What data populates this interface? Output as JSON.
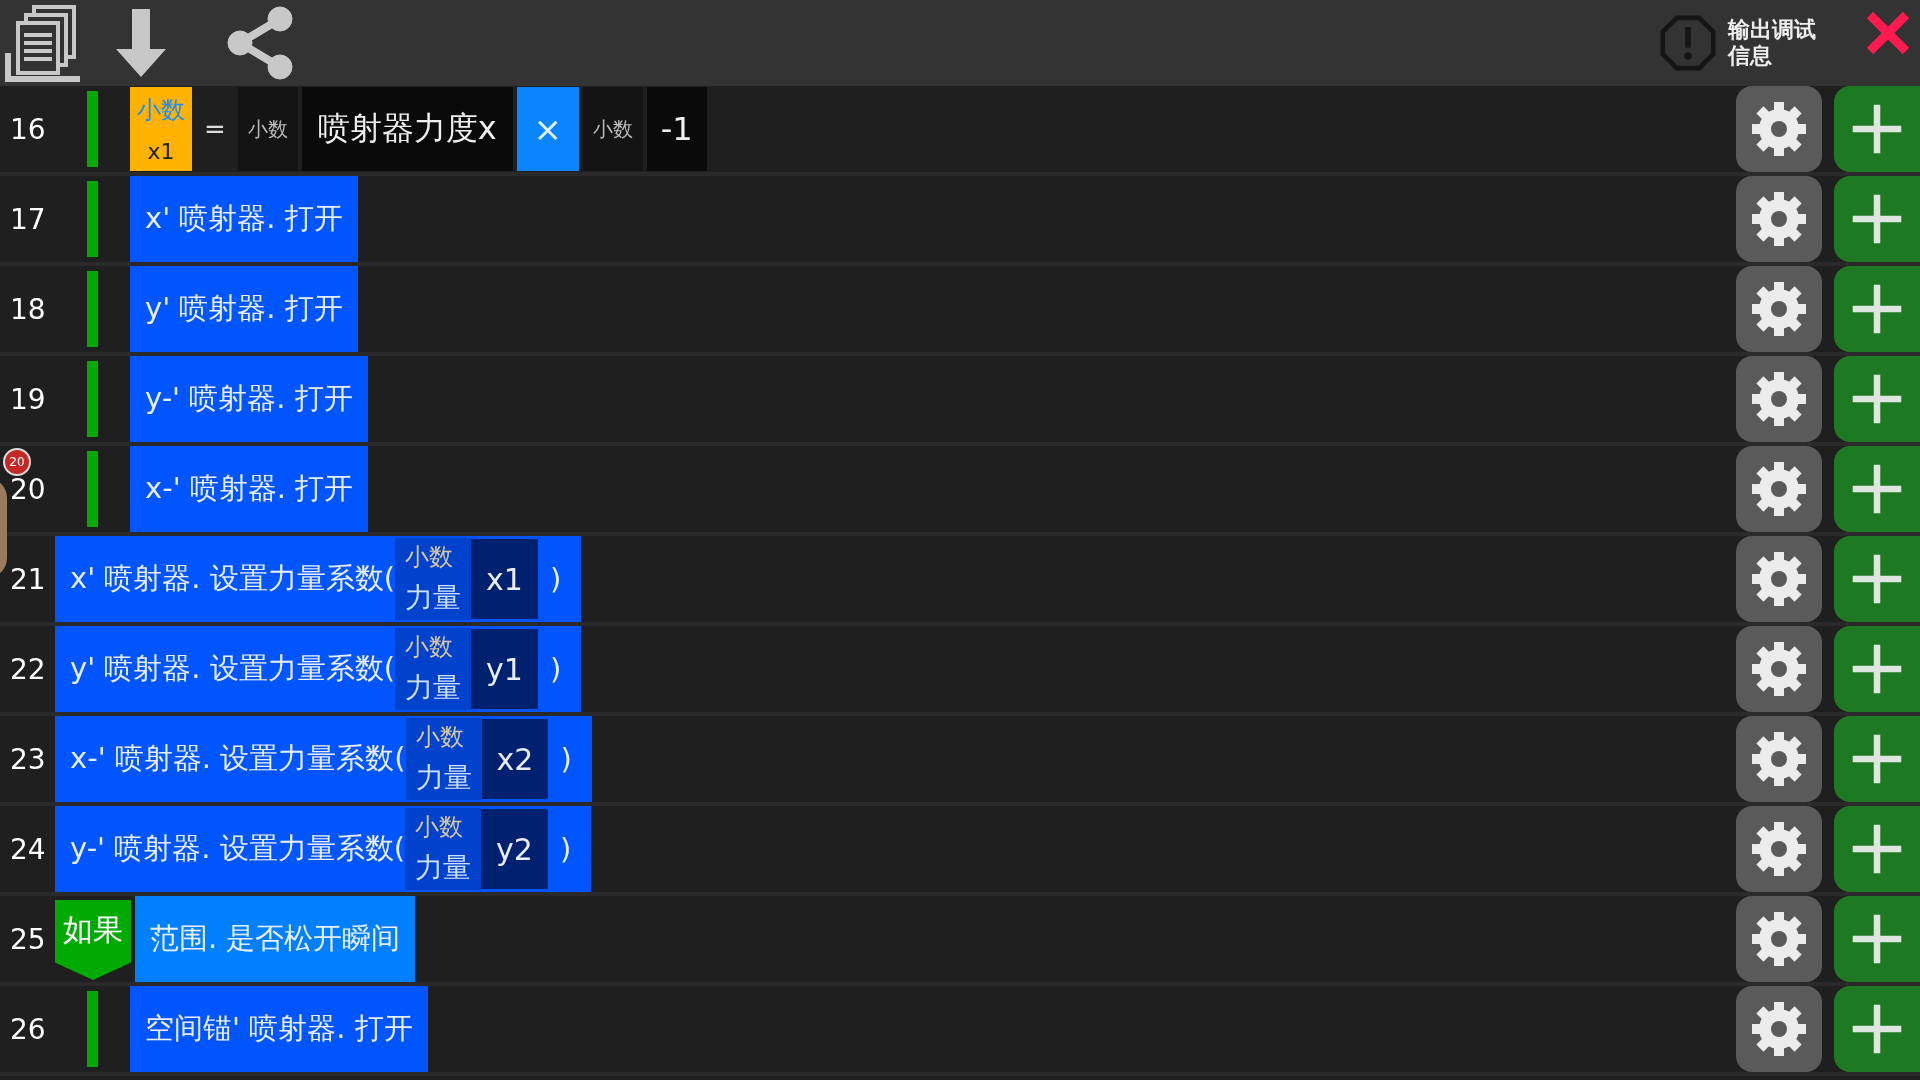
{
  "toolbar": {
    "debug_button": "输出调试信息"
  },
  "rows": [
    {
      "number": "16",
      "indented": true,
      "kind": "assign",
      "target_type": "小数",
      "target_name": "x1",
      "equals": "=",
      "left_type": "小数",
      "left_value": "喷射器力度x",
      "operator": "×",
      "right_type": "小数",
      "right_value": "-1"
    },
    {
      "number": "17",
      "indented": true,
      "kind": "call",
      "text": "x' 喷射器. 打开"
    },
    {
      "number": "18",
      "indented": true,
      "kind": "call",
      "text": "y' 喷射器. 打开"
    },
    {
      "number": "19",
      "indented": true,
      "kind": "call",
      "text": "y-' 喷射器. 打开"
    },
    {
      "number": "20",
      "indented": true,
      "kind": "call",
      "text": "x-' 喷射器. 打开"
    },
    {
      "number": "21",
      "indented": false,
      "kind": "call_param",
      "text": "x' 喷射器. 设置力量系数(",
      "param_type": "小数",
      "param_name": "力量",
      "param_value": "x1",
      "close": ")"
    },
    {
      "number": "22",
      "indented": false,
      "kind": "call_param",
      "text": "y' 喷射器. 设置力量系数(",
      "param_type": "小数",
      "param_name": "力量",
      "param_value": "y1",
      "close": ")"
    },
    {
      "number": "23",
      "indented": false,
      "kind": "call_param",
      "text": "x-' 喷射器. 设置力量系数(",
      "param_type": "小数",
      "param_name": "力量",
      "param_value": "x2",
      "close": ")"
    },
    {
      "number": "24",
      "indented": false,
      "kind": "call_param",
      "text": "y-' 喷射器. 设置力量系数(",
      "param_type": "小数",
      "param_name": "力量",
      "param_value": "y2",
      "close": ")"
    },
    {
      "number": "25",
      "indented": false,
      "kind": "if",
      "keyword": "如果",
      "text": "范围. 是否松开瞬间"
    },
    {
      "number": "26",
      "indented": true,
      "kind": "call",
      "text": "空间锚' 喷射器. 打开"
    }
  ],
  "floating_badge": "20"
}
